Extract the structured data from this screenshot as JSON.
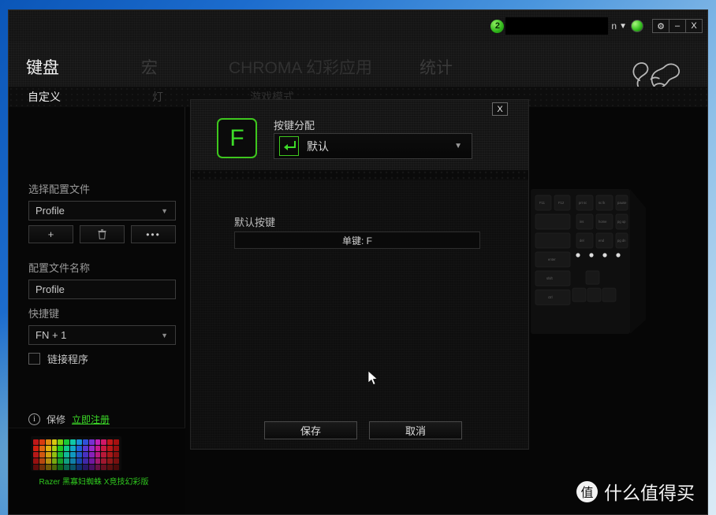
{
  "titlebar": {
    "notification_count": "2",
    "account_name": "n",
    "caret": "▼",
    "settings_icon": "⚙",
    "minimize_label": "–",
    "close_label": "X"
  },
  "main_tabs": [
    {
      "label": "键盘",
      "active": true
    },
    {
      "label": "宏",
      "active": false
    },
    {
      "label": "CHROMA 幻彩应用",
      "active": false
    },
    {
      "label": "统计",
      "active": false
    }
  ],
  "sub_tabs": [
    {
      "label": "自定义",
      "active": true
    },
    {
      "label": "灯",
      "active": false
    },
    {
      "label": "游戏模式",
      "active": false
    }
  ],
  "sidebar": {
    "profile_select_label": "选择配置文件",
    "profile_select_value": "Profile",
    "add_button": "+",
    "delete_button": "🗑",
    "more_button": "•••",
    "profile_name_label": "配置文件名称",
    "profile_name_value": "Profile",
    "profile_name_placeholder": "Profile",
    "shortcut_label": "快捷键",
    "shortcut_value": "FN + 1",
    "link_program_label": "链接程序",
    "link_program_checked": false,
    "warranty_label": "保修",
    "register_link": "立即注册",
    "device_name": "Razer 黑寡妇蜘蛛 X竞技幻彩版"
  },
  "modal": {
    "key_badge": "F",
    "assign_label": "按键分配",
    "assign_value": "默认",
    "assign_caret": "▼",
    "close_label": "X",
    "default_key_label": "默认按键",
    "default_key_value": "单键: F",
    "save_label": "保存",
    "cancel_label": "取消"
  },
  "watermark": {
    "logo_char": "值",
    "text": "什么值得买"
  },
  "colors": {
    "razer_green": "#3ddc28",
    "panel_bg": "#0a0a0a",
    "text_primary": "#e0e0e0",
    "text_muted": "#3a3a3a"
  }
}
